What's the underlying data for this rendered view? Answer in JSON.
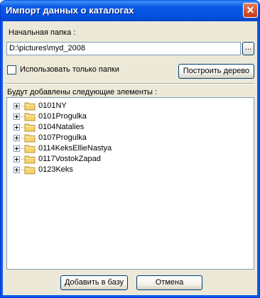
{
  "window": {
    "title": "Импорт данных о каталогах",
    "close_glyph": "✕"
  },
  "start_folder": {
    "label": "Начальная папка :",
    "value": "D:\\pictures\\myd_2008",
    "browse_label": "..."
  },
  "folders_only": {
    "label": "Использовать только папки",
    "checked": false
  },
  "build_tree_button": "Построить дерево",
  "items_label": "Будут добавлены следующие элементы :",
  "tree": {
    "icon": "folder-icon",
    "folder_color": "#f6d36b",
    "items": [
      {
        "label": "0101NY"
      },
      {
        "label": "0101Progulka"
      },
      {
        "label": "0104Natalies"
      },
      {
        "label": "0107Progulka"
      },
      {
        "label": "0114KeksEllieNastya"
      },
      {
        "label": "0117VostokZapad"
      },
      {
        "label": "0123Keks"
      }
    ]
  },
  "footer": {
    "add_label": "Добавить в базу",
    "cancel_label": "Отмена"
  },
  "colors": {
    "title_bar": "#0a5ce8",
    "dialog_background": "#ece9d8",
    "close_button": "#d44b2a"
  }
}
